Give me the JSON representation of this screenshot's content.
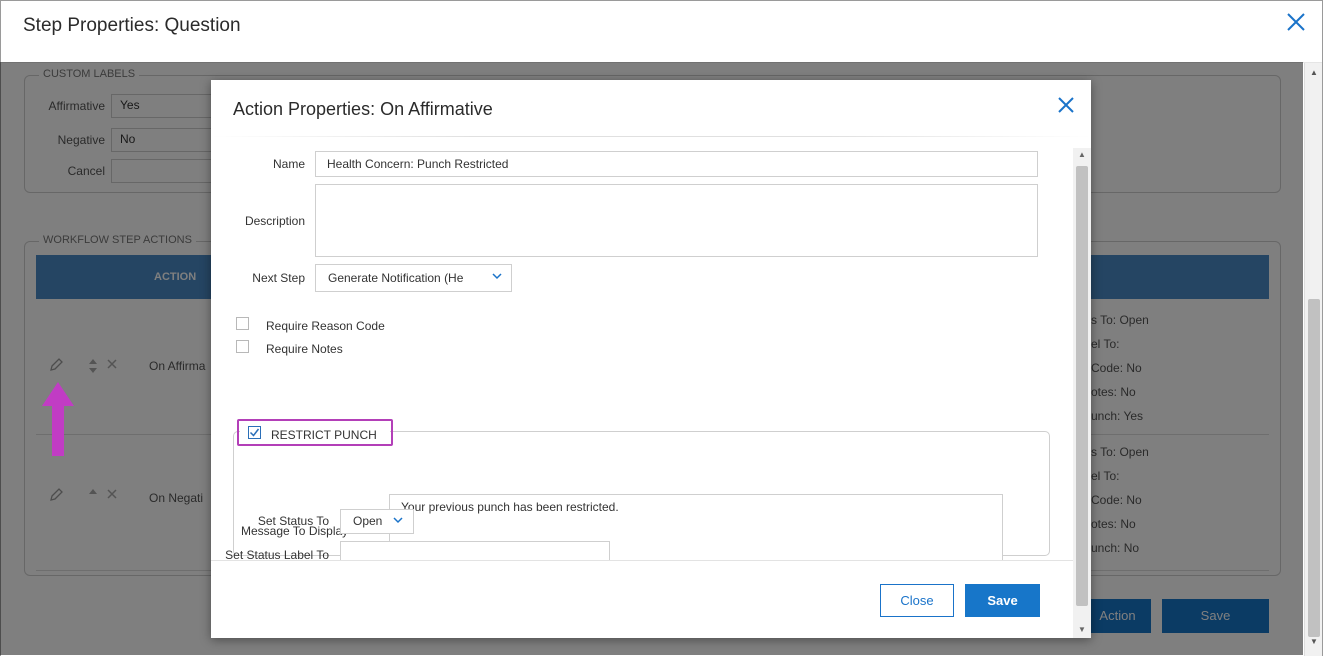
{
  "outer": {
    "title": "Step Properties: Question",
    "custom_labels_legend": "CUSTOM LABELS",
    "labels": [
      {
        "label": "Affirmative",
        "value": "Yes"
      },
      {
        "label": "Negative",
        "value": "No"
      },
      {
        "label": "Cancel",
        "value": ""
      }
    ],
    "workflow_legend": "WORKFLOW STEP ACTIONS",
    "table_header_action": "ACTION",
    "rows": [
      {
        "action": "On Affirma",
        "details": [
          "s To:  Open",
          "el To:",
          "Code:  No",
          "otes:  No",
          "unch:  Yes"
        ]
      },
      {
        "action": "On Negati",
        "details": [
          "s To:  Open",
          "el To:",
          "Code:  No",
          "otes:  No",
          "unch:  No"
        ]
      }
    ],
    "add_action_label": "Action",
    "save_label": "Save"
  },
  "modal": {
    "title": "Action Properties: On Affirmative",
    "name_label": "Name",
    "name_value": "Health Concern: Punch Restricted",
    "description_label": "Description",
    "description_value": "",
    "next_step_label": "Next Step",
    "next_step_value": "Generate Notification (He",
    "require_reason_code_label": "Require Reason Code",
    "require_notes_label": "Require Notes",
    "restrict_punch_label": "RESTRICT PUNCH",
    "message_label": "Message To Display",
    "message_value": "Your previous punch has been restricted.",
    "set_status_label": "Set Status To",
    "set_status_value": "Open",
    "set_status_label_to_label": "Set Status Label To",
    "set_status_label_to_value": "",
    "close_label": "Close",
    "save_label": "Save"
  },
  "colors": {
    "accent": "#1776c9",
    "highlight": "#b33fb8",
    "table_header": "#4a8bc7"
  },
  "icons": [
    "close-icon",
    "pencil-icon",
    "sort-icon",
    "delete-icon",
    "chevron-down-icon",
    "check-icon",
    "arrow-up-icon"
  ]
}
